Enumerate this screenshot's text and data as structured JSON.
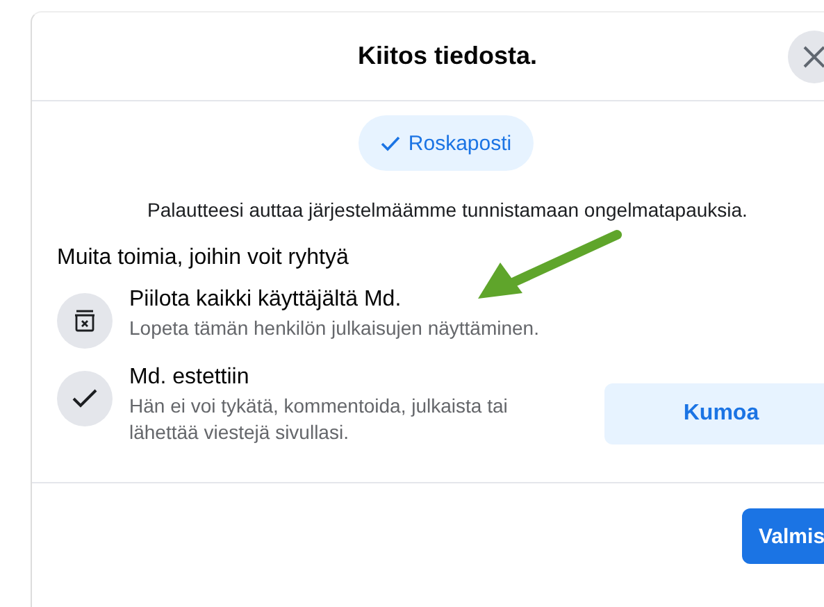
{
  "dialog": {
    "title": "Kiitos tiedosta.",
    "tag": {
      "label": "Roskaposti",
      "selected": true
    },
    "message": "Palautteesi auttaa järjestelmäämme tunnistamaan ongelmatapauksia.",
    "section_title": "Muita toimia, joihin voit ryhtyä",
    "actions": [
      {
        "kind": "hide",
        "title": "Piilota kaikki käyttäjältä Md.",
        "description": "Lopeta tämän henkilön julkaisujen näyttäminen."
      },
      {
        "kind": "blocked",
        "title": "Md. estettiin",
        "description": "Hän ei voi tykätä, kommentoida, julkaista tai lähettää viestejä sivullasi.",
        "button": "Kumoa"
      }
    ],
    "done_button": "Valmis"
  }
}
